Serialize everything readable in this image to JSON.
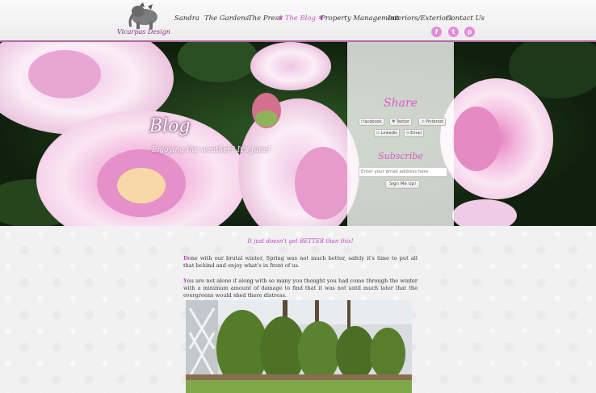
{
  "brand": {
    "name": "Vicarpas Design"
  },
  "nav": {
    "items": [
      {
        "label": "Sandra",
        "active": false
      },
      {
        "label": "The Gardens",
        "active": false
      },
      {
        "label": "The Press",
        "active": false
      },
      {
        "label": "The Blog",
        "active": true
      },
      {
        "label": "Property Management",
        "active": false
      },
      {
        "label": "Interiors/Exteriors",
        "active": false
      },
      {
        "label": "Contact Us",
        "active": false
      }
    ],
    "social_icons": [
      "facebook-icon",
      "twitter-icon",
      "pinterest-icon"
    ]
  },
  "hero": {
    "title": "Blog",
    "subtitle": "Enjoying the weather? It's June!"
  },
  "share": {
    "heading": "Share",
    "buttons": [
      {
        "label": "facebook",
        "icon": "facebook-icon"
      },
      {
        "label": "Twitter",
        "icon": "twitter-icon"
      },
      {
        "label": "Pinterest",
        "icon": "pinterest-icon"
      },
      {
        "label": "Linkedin",
        "icon": "linkedin-icon"
      },
      {
        "label": "Email",
        "icon": "email-icon"
      }
    ]
  },
  "subscribe": {
    "heading": "Subscribe",
    "email_placeholder": "Enter your email address here",
    "button_label": "Sign Me Up!"
  },
  "post": {
    "tagline": "It just doesn't get BETTER than this!",
    "para1_cap": "D",
    "para1": "one with our brutal winter, Spring was not much better, safely it's time to put all that behind and enjoy what's in front of us.",
    "para2_cap": "Y",
    "para2": "ou are not alone if along with so many you thought you had come through the winter with a minimum amount of damage to find that it was not until much later that the evergreens would shed there distress."
  },
  "colors": {
    "accent": "#d255c6",
    "header_border": "#b46aa4",
    "panel_heading": "#de57c9"
  }
}
